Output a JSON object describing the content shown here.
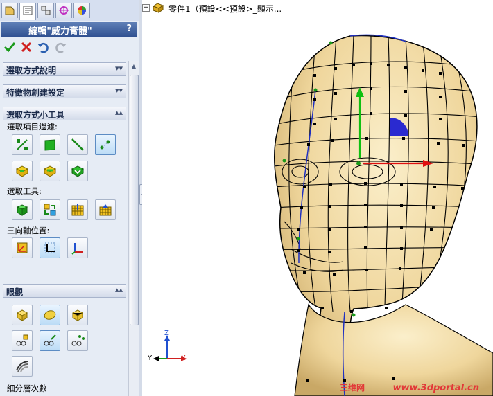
{
  "panel": {
    "title": "編輯\"威力膏體\"",
    "help": "?",
    "tabs": [
      "feature-manager",
      "property-manager",
      "configuration-manager",
      "dimxpert-manager",
      "display-manager"
    ],
    "groups": {
      "selection_help": "選取方式說明",
      "feature_creation": "特徵物創建設定",
      "selection_tools": "選取方式小工具",
      "display": "眼觀"
    },
    "labels": {
      "filter": "選取項目過濾:",
      "tools": "選取工具:",
      "triad": "三向軸位置:",
      "subdivision": "細分層次數"
    }
  },
  "viewport": {
    "tree_text": "零件1（預設<<預設>_顯示...",
    "triad": {
      "z": "Z",
      "y": "Y",
      "x": "X"
    },
    "watermark_cn": "三维网",
    "watermark_url": "www.3dportal.cn"
  },
  "colors": {
    "accent": "#2e4f8f",
    "ok": "#1a9a1a",
    "cancel": "#d02020",
    "skin": "#f1dca6"
  }
}
